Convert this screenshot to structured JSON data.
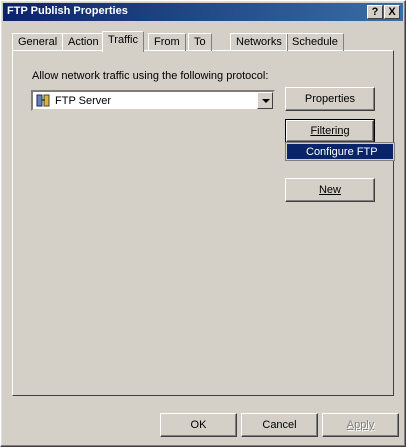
{
  "window": {
    "title": "FTP Publish Properties",
    "help_label": "?",
    "close_label": "X"
  },
  "tabs": [
    {
      "label": "General"
    },
    {
      "label": "Action"
    },
    {
      "label": "Traffic"
    },
    {
      "label": "From"
    },
    {
      "label": "To"
    },
    {
      "label": "Networks"
    },
    {
      "label": "Schedule"
    }
  ],
  "traffic": {
    "protocol_label": "Allow network traffic using the following protocol:",
    "protocol_value": "FTP Server",
    "properties_label": "Properties",
    "filtering_label": "Filtering",
    "new_label": "New"
  },
  "context_menu": {
    "items": [
      {
        "label": "Configure FTP"
      }
    ]
  },
  "footer": {
    "ok_label": "OK",
    "cancel_label": "Cancel",
    "apply_label": "Apply"
  }
}
